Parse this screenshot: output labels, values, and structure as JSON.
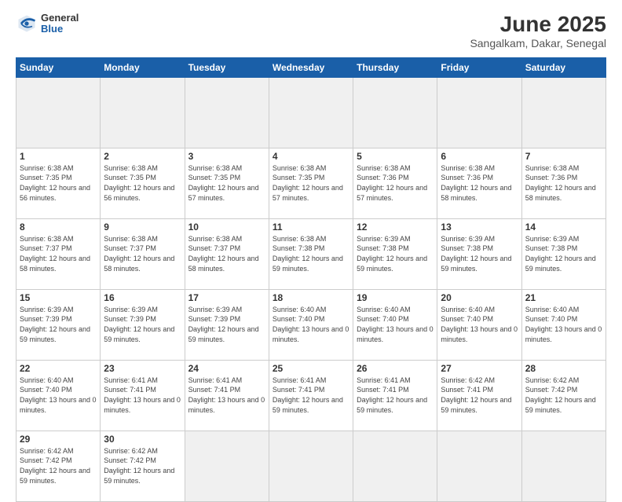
{
  "header": {
    "logo_general": "General",
    "logo_blue": "Blue",
    "title": "June 2025",
    "subtitle": "Sangalkam, Dakar, Senegal"
  },
  "calendar": {
    "weekdays": [
      "Sunday",
      "Monday",
      "Tuesday",
      "Wednesday",
      "Thursday",
      "Friday",
      "Saturday"
    ],
    "weeks": [
      [
        null,
        null,
        null,
        null,
        null,
        null,
        null
      ],
      [
        {
          "day": "1",
          "sunrise": "6:38 AM",
          "sunset": "7:35 PM",
          "daylight": "12 hours and 56 minutes."
        },
        {
          "day": "2",
          "sunrise": "6:38 AM",
          "sunset": "7:35 PM",
          "daylight": "12 hours and 56 minutes."
        },
        {
          "day": "3",
          "sunrise": "6:38 AM",
          "sunset": "7:35 PM",
          "daylight": "12 hours and 57 minutes."
        },
        {
          "day": "4",
          "sunrise": "6:38 AM",
          "sunset": "7:35 PM",
          "daylight": "12 hours and 57 minutes."
        },
        {
          "day": "5",
          "sunrise": "6:38 AM",
          "sunset": "7:36 PM",
          "daylight": "12 hours and 57 minutes."
        },
        {
          "day": "6",
          "sunrise": "6:38 AM",
          "sunset": "7:36 PM",
          "daylight": "12 hours and 58 minutes."
        },
        {
          "day": "7",
          "sunrise": "6:38 AM",
          "sunset": "7:36 PM",
          "daylight": "12 hours and 58 minutes."
        }
      ],
      [
        {
          "day": "8",
          "sunrise": "6:38 AM",
          "sunset": "7:37 PM",
          "daylight": "12 hours and 58 minutes."
        },
        {
          "day": "9",
          "sunrise": "6:38 AM",
          "sunset": "7:37 PM",
          "daylight": "12 hours and 58 minutes."
        },
        {
          "day": "10",
          "sunrise": "6:38 AM",
          "sunset": "7:37 PM",
          "daylight": "12 hours and 58 minutes."
        },
        {
          "day": "11",
          "sunrise": "6:38 AM",
          "sunset": "7:38 PM",
          "daylight": "12 hours and 59 minutes."
        },
        {
          "day": "12",
          "sunrise": "6:39 AM",
          "sunset": "7:38 PM",
          "daylight": "12 hours and 59 minutes."
        },
        {
          "day": "13",
          "sunrise": "6:39 AM",
          "sunset": "7:38 PM",
          "daylight": "12 hours and 59 minutes."
        },
        {
          "day": "14",
          "sunrise": "6:39 AM",
          "sunset": "7:38 PM",
          "daylight": "12 hours and 59 minutes."
        }
      ],
      [
        {
          "day": "15",
          "sunrise": "6:39 AM",
          "sunset": "7:39 PM",
          "daylight": "12 hours and 59 minutes."
        },
        {
          "day": "16",
          "sunrise": "6:39 AM",
          "sunset": "7:39 PM",
          "daylight": "12 hours and 59 minutes."
        },
        {
          "day": "17",
          "sunrise": "6:39 AM",
          "sunset": "7:39 PM",
          "daylight": "12 hours and 59 minutes."
        },
        {
          "day": "18",
          "sunrise": "6:40 AM",
          "sunset": "7:40 PM",
          "daylight": "13 hours and 0 minutes."
        },
        {
          "day": "19",
          "sunrise": "6:40 AM",
          "sunset": "7:40 PM",
          "daylight": "13 hours and 0 minutes."
        },
        {
          "day": "20",
          "sunrise": "6:40 AM",
          "sunset": "7:40 PM",
          "daylight": "13 hours and 0 minutes."
        },
        {
          "day": "21",
          "sunrise": "6:40 AM",
          "sunset": "7:40 PM",
          "daylight": "13 hours and 0 minutes."
        }
      ],
      [
        {
          "day": "22",
          "sunrise": "6:40 AM",
          "sunset": "7:40 PM",
          "daylight": "13 hours and 0 minutes."
        },
        {
          "day": "23",
          "sunrise": "6:41 AM",
          "sunset": "7:41 PM",
          "daylight": "13 hours and 0 minutes."
        },
        {
          "day": "24",
          "sunrise": "6:41 AM",
          "sunset": "7:41 PM",
          "daylight": "13 hours and 0 minutes."
        },
        {
          "day": "25",
          "sunrise": "6:41 AM",
          "sunset": "7:41 PM",
          "daylight": "12 hours and 59 minutes."
        },
        {
          "day": "26",
          "sunrise": "6:41 AM",
          "sunset": "7:41 PM",
          "daylight": "12 hours and 59 minutes."
        },
        {
          "day": "27",
          "sunrise": "6:42 AM",
          "sunset": "7:41 PM",
          "daylight": "12 hours and 59 minutes."
        },
        {
          "day": "28",
          "sunrise": "6:42 AM",
          "sunset": "7:42 PM",
          "daylight": "12 hours and 59 minutes."
        }
      ],
      [
        {
          "day": "29",
          "sunrise": "6:42 AM",
          "sunset": "7:42 PM",
          "daylight": "12 hours and 59 minutes."
        },
        {
          "day": "30",
          "sunrise": "6:42 AM",
          "sunset": "7:42 PM",
          "daylight": "12 hours and 59 minutes."
        },
        null,
        null,
        null,
        null,
        null
      ]
    ]
  }
}
